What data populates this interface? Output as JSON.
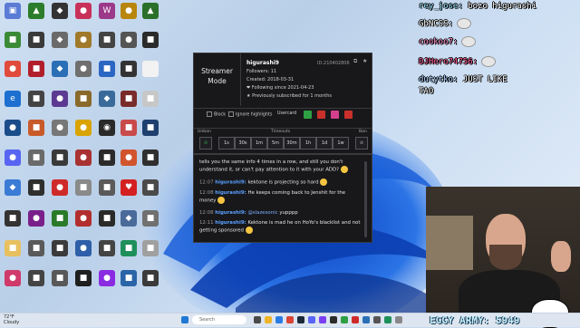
{
  "desktop_icons": [
    {
      "label": "",
      "color": "#5b7bd5",
      "glyph": "▣"
    },
    {
      "label": "",
      "color": "#2b7d2b",
      "glyph": "▲"
    },
    {
      "label": "",
      "color": "#333333",
      "glyph": "◆"
    },
    {
      "label": "",
      "color": "#c8325a",
      "glyph": "●"
    },
    {
      "label": "",
      "color": "#9c3a8a",
      "glyph": "W"
    },
    {
      "label": "",
      "color": "#b8860b",
      "glyph": "●"
    },
    {
      "label": "",
      "color": "#2a6f2a",
      "glyph": "▲"
    },
    {
      "label": "",
      "color": "#3b8a36",
      "glyph": "■"
    },
    {
      "label": "",
      "color": "#3a3a3a",
      "glyph": "■"
    },
    {
      "label": "",
      "color": "#6a6a6a",
      "glyph": "◆"
    },
    {
      "label": "",
      "color": "#a07a2a",
      "glyph": "●"
    },
    {
      "label": "",
      "color": "#444444",
      "glyph": "■"
    },
    {
      "label": "",
      "color": "#555555",
      "glyph": "●"
    },
    {
      "label": "",
      "color": "#2a2a2a",
      "glyph": "■"
    },
    {
      "label": "",
      "color": "#e04b3c",
      "glyph": "●"
    },
    {
      "label": "",
      "color": "#b11f2b",
      "glyph": "■"
    },
    {
      "label": "",
      "color": "#2a6fb5",
      "glyph": "◆"
    },
    {
      "label": "",
      "color": "#6f6f6f",
      "glyph": "●"
    },
    {
      "label": "",
      "color": "#2b66c2",
      "glyph": "■"
    },
    {
      "label": "",
      "color": "#333333",
      "glyph": "■"
    },
    {
      "label": "",
      "color": "#f2f2f2",
      "glyph": ""
    },
    {
      "label": "",
      "color": "#1d6fd0",
      "glyph": "e"
    },
    {
      "label": "",
      "color": "#444444",
      "glyph": "■"
    },
    {
      "label": "",
      "color": "#5c3a92",
      "glyph": "●"
    },
    {
      "label": "",
      "color": "#8a6a2a",
      "glyph": "■"
    },
    {
      "label": "",
      "color": "#3a6a9a",
      "glyph": "◆"
    },
    {
      "label": "",
      "color": "#7a2a2a",
      "glyph": "■"
    },
    {
      "label": "",
      "color": "#c7c7c7",
      "glyph": "■"
    },
    {
      "label": "",
      "color": "#1b4d8a",
      "glyph": "●"
    },
    {
      "label": "",
      "color": "#c85a2a",
      "glyph": "■"
    },
    {
      "label": "",
      "color": "#777777",
      "glyph": "●"
    },
    {
      "label": "",
      "color": "#d9a400",
      "glyph": "●"
    },
    {
      "label": "",
      "color": "#2a2a2a",
      "glyph": "◉"
    },
    {
      "label": "",
      "color": "#c94a4a",
      "glyph": "■"
    },
    {
      "label": "",
      "color": "#1f3f6f",
      "glyph": "■"
    },
    {
      "label": "",
      "color": "#5865f2",
      "glyph": "●"
    },
    {
      "label": "",
      "color": "#6a6a6a",
      "glyph": "■"
    },
    {
      "label": "",
      "color": "#3a3a3a",
      "glyph": "■"
    },
    {
      "label": "",
      "color": "#a83232",
      "glyph": "●"
    },
    {
      "label": "",
      "color": "#2b2b2b",
      "glyph": "■"
    },
    {
      "label": "",
      "color": "#d2542d",
      "glyph": "●"
    },
    {
      "label": "",
      "color": "#2f2f2f",
      "glyph": "■"
    },
    {
      "label": "",
      "color": "#3a7bd5",
      "glyph": "◆"
    },
    {
      "label": "",
      "color": "#2f2f2f",
      "glyph": "■"
    },
    {
      "label": "",
      "color": "#cf2a2a",
      "glyph": "●"
    },
    {
      "label": "",
      "color": "#8a8a8a",
      "glyph": "■"
    },
    {
      "label": "",
      "color": "#5a5a5a",
      "glyph": "■"
    },
    {
      "label": "",
      "color": "#d42020",
      "glyph": "♥"
    },
    {
      "label": "",
      "color": "#4a4a4a",
      "glyph": "■"
    },
    {
      "label": "",
      "color": "#333333",
      "glyph": "■"
    },
    {
      "label": "",
      "color": "#7a1f8a",
      "glyph": "●"
    },
    {
      "label": "",
      "color": "#2a7a2a",
      "glyph": "■"
    },
    {
      "label": "",
      "color": "#b22e2e",
      "glyph": "●"
    },
    {
      "label": "",
      "color": "#2a2a2a",
      "glyph": "■"
    },
    {
      "label": "",
      "color": "#4a6a9a",
      "glyph": "◆"
    },
    {
      "label": "",
      "color": "#707070",
      "glyph": "■"
    },
    {
      "label": "",
      "color": "#e8c060",
      "glyph": "■"
    },
    {
      "label": "",
      "color": "#5a5a5a",
      "glyph": "■"
    },
    {
      "label": "",
      "color": "#3b3b3b",
      "glyph": "■"
    },
    {
      "label": "",
      "color": "#2e5fa8",
      "glyph": "●"
    },
    {
      "label": "",
      "color": "#444444",
      "glyph": "■"
    },
    {
      "label": "",
      "color": "#1e8f5a",
      "glyph": "■"
    },
    {
      "label": "",
      "color": "#a0a0a0",
      "glyph": "■"
    },
    {
      "label": "",
      "color": "#cf3a6b",
      "glyph": "●"
    },
    {
      "label": "",
      "color": "#444444",
      "glyph": "■"
    },
    {
      "label": "",
      "color": "#585858",
      "glyph": "■"
    },
    {
      "label": "",
      "color": "#1f1f1f",
      "glyph": "■"
    },
    {
      "label": "",
      "color": "#8a2be2",
      "glyph": "●"
    },
    {
      "label": "",
      "color": "#2b65a8",
      "glyph": "■"
    },
    {
      "label": "",
      "color": "#3a3a3a",
      "glyph": "■"
    }
  ],
  "chat_overlay": [
    {
      "user": "rey_jose:",
      "text": " bozo higurashi",
      "user_color": "#9be7ff"
    },
    {
      "user": "GbNCSS:",
      "text": "",
      "user_color": "#ffffff"
    },
    {
      "user": "cookoo7:",
      "text": "",
      "user_color": "#ff8fc7"
    },
    {
      "user": "DJHero74756:",
      "text": "",
      "user_color": "#ff5c9a"
    },
    {
      "user": "dutytko:",
      "text": " JUST LIKE",
      "user_color": "#b3d4ff"
    },
    {
      "user": "",
      "text": "TAO",
      "user_color": "#ffffff"
    }
  ],
  "mod_card": {
    "mode_label": "Streamer\nMode",
    "username": "higurashi9",
    "user_id": "ID:210402806",
    "followers": "Followers: 11",
    "created": "Created: 2018-03-31",
    "following": "❤ Following since 2021-04-23",
    "subscribed": "★ Previously subscribed for 1 months",
    "block_label": "Block",
    "ignore_label": "Ignore highlights",
    "usercard_label": "Usercard",
    "unban_label": "Unban",
    "timeouts_label": "Timeouts",
    "ban_label": "Ban",
    "timeouts": [
      "1s",
      "30s",
      "1m",
      "5m",
      "30m",
      "1h",
      "1d",
      "1w"
    ]
  },
  "chat_popup": {
    "messages": [
      {
        "time": "",
        "user": "",
        "text": "tells you the same info 4 times in a row, and still you don't understand it, or can't pay attention to it with your ADD?"
      },
      {
        "time": "12:07",
        "user": "higurashi9:",
        "text": " kektone is projecting so hard"
      },
      {
        "time": "12:08",
        "user": "higurashi9:",
        "text": " He keeps coming back to Jenshit for the money"
      },
      {
        "time": "12:08",
        "user": "higurashi9:",
        "text": " ",
        "mention": "@slazesonic",
        "after": " yupppp"
      },
      {
        "time": "12:11",
        "user": "higurashi9:",
        "text": " Kektone is mad he on HoYo's blacklist and not getting sponsored"
      }
    ]
  },
  "taskbar": {
    "weather_temp": "72°F",
    "weather_desc": "Cloudy",
    "search_placeholder": "Search"
  },
  "stream": {
    "eggy_army": "EGGY ARMY: 5949"
  }
}
